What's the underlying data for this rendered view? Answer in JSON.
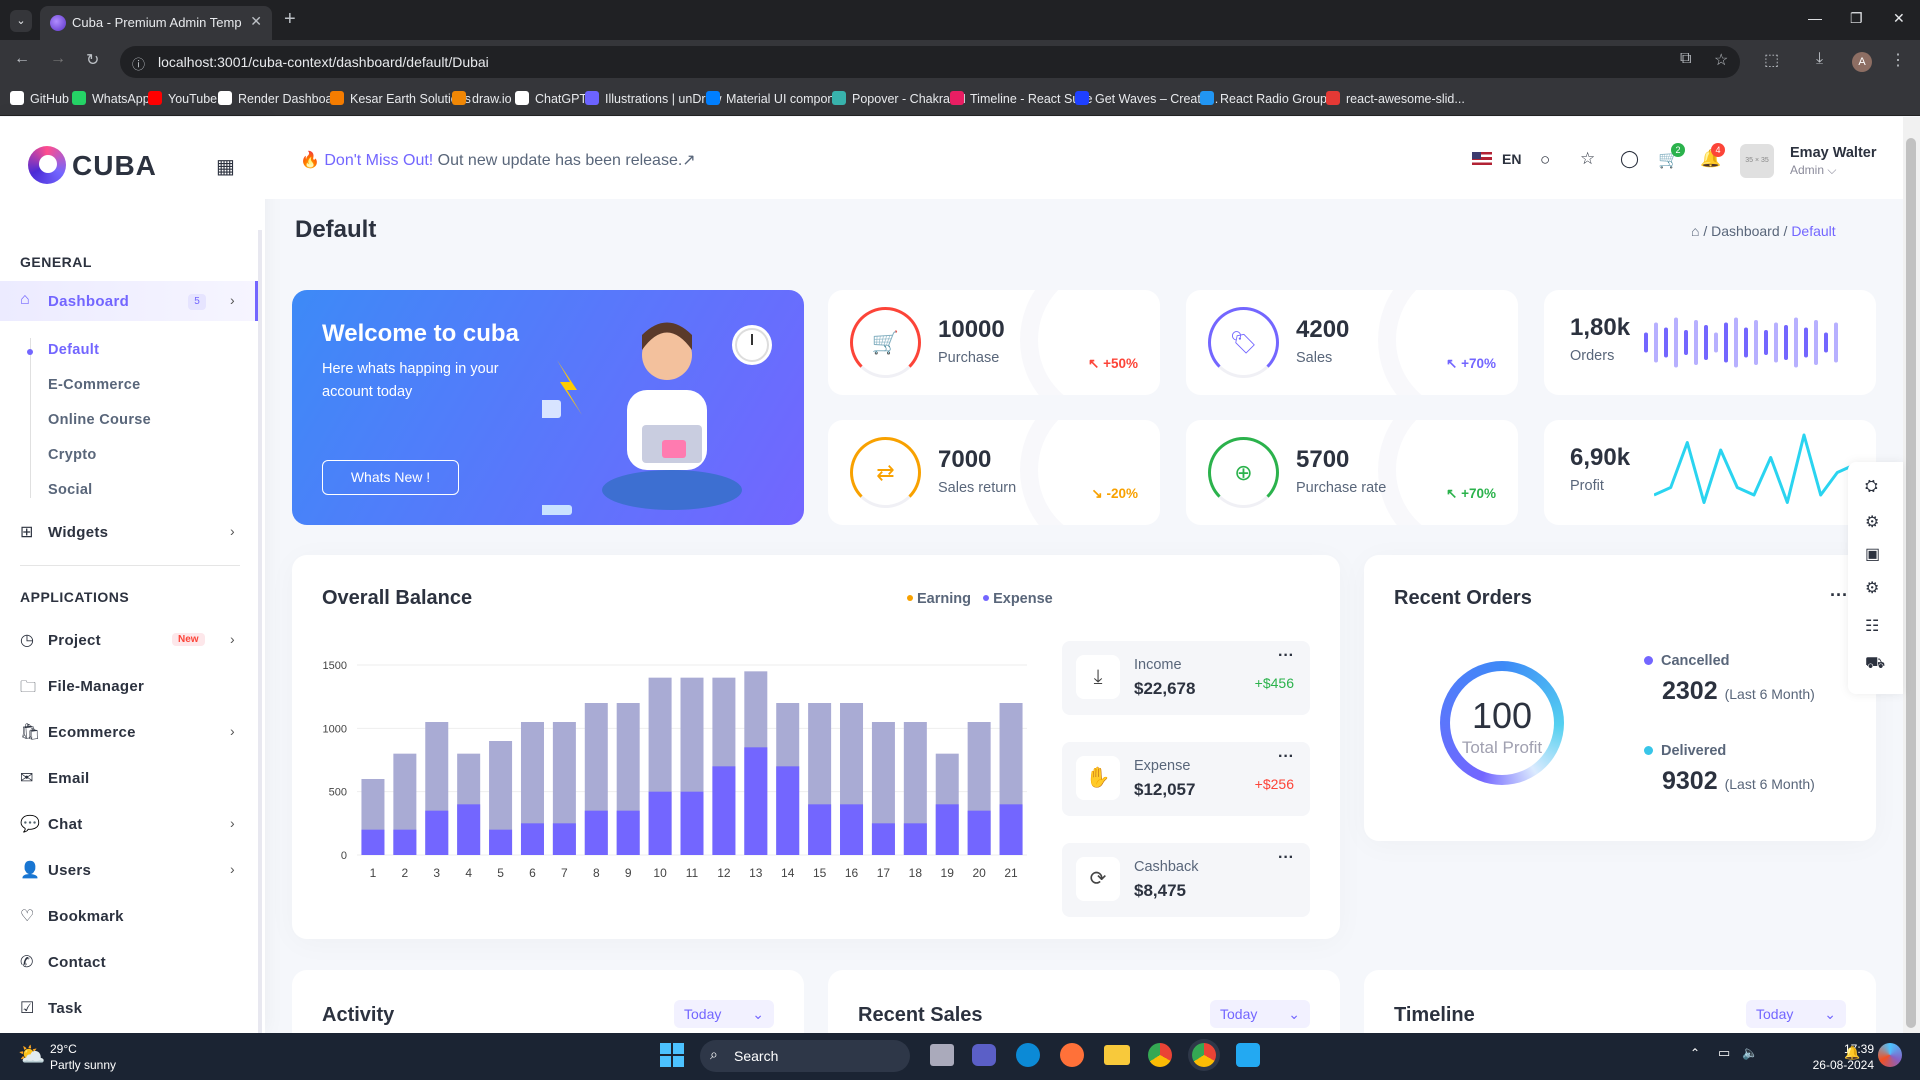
{
  "browser": {
    "tab_title": "Cuba - Premium Admin Template",
    "url": "localhost:3001/cuba-context/dashboard/default/Dubai",
    "bookmarks": [
      {
        "label": "GitHub",
        "color": "#ffffff"
      },
      {
        "label": "WhatsApp",
        "color": "#25d366"
      },
      {
        "label": "YouTube",
        "color": "#ff0000"
      },
      {
        "label": "Render Dashboard",
        "color": "#ffffff"
      },
      {
        "label": "Kesar Earth Solutions",
        "color": "#f57c00"
      },
      {
        "label": "draw.io",
        "color": "#f08705"
      },
      {
        "label": "ChatGPT",
        "color": "#ffffff"
      },
      {
        "label": "Illustrations | unDraw",
        "color": "#6c63ff"
      },
      {
        "label": "Material UI compon...",
        "color": "#007fff"
      },
      {
        "label": "Popover - Chakra UI",
        "color": "#38b2ac"
      },
      {
        "label": "Timeline - React Suite",
        "color": "#e91e63"
      },
      {
        "label": "Get Waves – Create...",
        "color": "#1e40ff"
      },
      {
        "label": "React Radio Group...",
        "color": "#2196f3"
      },
      {
        "label": "react-awesome-slid...",
        "color": "#e53935"
      }
    ]
  },
  "brand": {
    "name": "CUBA",
    "accent": "#7366ff"
  },
  "sidebar": {
    "general_title": "GENERAL",
    "dashboard": {
      "label": "Dashboard",
      "badge": "5"
    },
    "sub_items": [
      "Default",
      "E-Commerce",
      "Online Course",
      "Crypto",
      "Social"
    ],
    "widgets": "Widgets",
    "applications_title": "APPLICATIONS",
    "apps": [
      {
        "label": "Project",
        "badge": "New",
        "icon": "project-icon",
        "glyph": "◷",
        "chevron": true
      },
      {
        "label": "File-Manager",
        "icon": "file-icon",
        "glyph": "🗀",
        "chevron": false
      },
      {
        "label": "Ecommerce",
        "icon": "bag-icon",
        "glyph": "🛍",
        "chevron": true
      },
      {
        "label": "Email",
        "icon": "email-icon",
        "glyph": "✉",
        "chevron": false
      },
      {
        "label": "Chat",
        "icon": "chat-icon",
        "glyph": "💬",
        "chevron": true
      },
      {
        "label": "Users",
        "icon": "users-icon",
        "glyph": "👤",
        "chevron": true
      },
      {
        "label": "Bookmark",
        "icon": "heart-icon",
        "glyph": "♡",
        "chevron": false
      },
      {
        "label": "Contact",
        "icon": "phone-icon",
        "glyph": "✆",
        "chevron": false
      },
      {
        "label": "Task",
        "icon": "task-icon",
        "glyph": "☑",
        "chevron": false
      }
    ]
  },
  "header": {
    "notice_highlight": "Don't Miss Out!",
    "notice_text": " Out new update has been release.↗",
    "language": "EN",
    "cart_count": "2",
    "notif_count": "4",
    "avatar_text": "35 × 35",
    "user_name": "Emay Walter",
    "user_role": "Admin ⌵"
  },
  "page": {
    "title": "Default",
    "breadcrumb": [
      "Dashboard",
      "Default"
    ]
  },
  "welcome": {
    "heading": "Welcome to cuba",
    "text": "Here whats happing in your account today",
    "button": "Whats New !"
  },
  "stats": [
    {
      "value": "10000",
      "label": "Purchase",
      "change": "↖ +50%",
      "color": "#fc4438",
      "icon": "cart-icon",
      "glyph": "🛒"
    },
    {
      "value": "4200",
      "label": "Sales",
      "change": "↖ +70%",
      "color": "#7366ff",
      "icon": "tag-icon",
      "glyph": "🏷"
    },
    {
      "value": "7000",
      "label": "Sales return",
      "change": "↘ -20%",
      "color": "#f8a100",
      "icon": "return-icon",
      "glyph": "⇄"
    },
    {
      "value": "5700",
      "label": "Purchase rate",
      "change": "↖ +70%",
      "color": "#2bb24c",
      "icon": "rate-icon",
      "glyph": "⊕"
    }
  ],
  "mini_stats": [
    {
      "value": "1,80k",
      "label": "Orders",
      "bars": [
        0.4,
        0.8,
        0.6,
        1.0,
        0.5,
        0.9,
        0.7,
        0.4,
        0.8,
        1.0,
        0.6,
        0.9,
        0.5,
        0.8,
        0.7,
        1.0,
        0.6,
        0.9,
        0.4,
        0.8
      ]
    },
    {
      "value": "6,90k",
      "label": "Profit",
      "wave": [
        0.2,
        0.3,
        0.9,
        0.1,
        0.8,
        0.3,
        0.2,
        0.7,
        0.1,
        1.0,
        0.2,
        0.5,
        0.6
      ]
    }
  ],
  "balance": {
    "title": "Overall Balance",
    "legend": [
      "Earning",
      "Expense"
    ],
    "info": [
      {
        "title": "Income",
        "value": "$22,678",
        "change": "+$456",
        "color": "#2bb24c",
        "icon": "download-icon",
        "glyph": "⤓"
      },
      {
        "title": "Expense",
        "value": "$12,057",
        "change": "+$256",
        "color": "#fc4438",
        "icon": "hand-icon",
        "glyph": "✋"
      },
      {
        "title": "Cashback",
        "value": "$8,475",
        "change": "",
        "color": "#2bb24c",
        "icon": "cashback-icon",
        "glyph": "⟳"
      }
    ]
  },
  "chart_data": {
    "type": "bar",
    "categories": [
      "1",
      "2",
      "3",
      "4",
      "5",
      "6",
      "7",
      "8",
      "9",
      "10",
      "11",
      "12",
      "13",
      "14",
      "15",
      "16",
      "17",
      "18",
      "19",
      "20",
      "21"
    ],
    "series": [
      {
        "name": "Earning",
        "values": [
          600,
          800,
          1050,
          800,
          900,
          1050,
          1050,
          1200,
          1200,
          1400,
          1400,
          1400,
          1450,
          1200,
          1200,
          1200,
          1050,
          1050,
          800,
          1050,
          1200
        ],
        "color": "#a9abd4"
      },
      {
        "name": "Expense",
        "values": [
          200,
          200,
          350,
          400,
          200,
          250,
          250,
          350,
          350,
          500,
          500,
          700,
          850,
          700,
          400,
          400,
          250,
          250,
          400,
          350,
          400
        ],
        "color": "#7366ff"
      }
    ],
    "stacked": false,
    "yticks": [
      0,
      500,
      1000,
      1500
    ],
    "ylim": [
      0,
      1500
    ],
    "grid": true
  },
  "orders": {
    "title": "Recent Orders",
    "center_value": "100",
    "center_label": "Total Profit",
    "items": [
      {
        "label": "Cancelled",
        "value": "2302",
        "period": "(Last 6 Month)",
        "color": "#7366ff"
      },
      {
        "label": "Delivered",
        "value": "9302",
        "period": "(Last 6 Month)",
        "color": "#38c5e8"
      }
    ]
  },
  "bottom": [
    {
      "title": "Activity",
      "filter": "Today"
    },
    {
      "title": "Recent Sales",
      "filter": "Today"
    },
    {
      "title": "Timeline",
      "filter": "Today"
    }
  ],
  "taskbar": {
    "temp": "29°C",
    "weather": "Partly sunny",
    "search": "Search",
    "time": "17:39",
    "date": "26-08-2024"
  }
}
